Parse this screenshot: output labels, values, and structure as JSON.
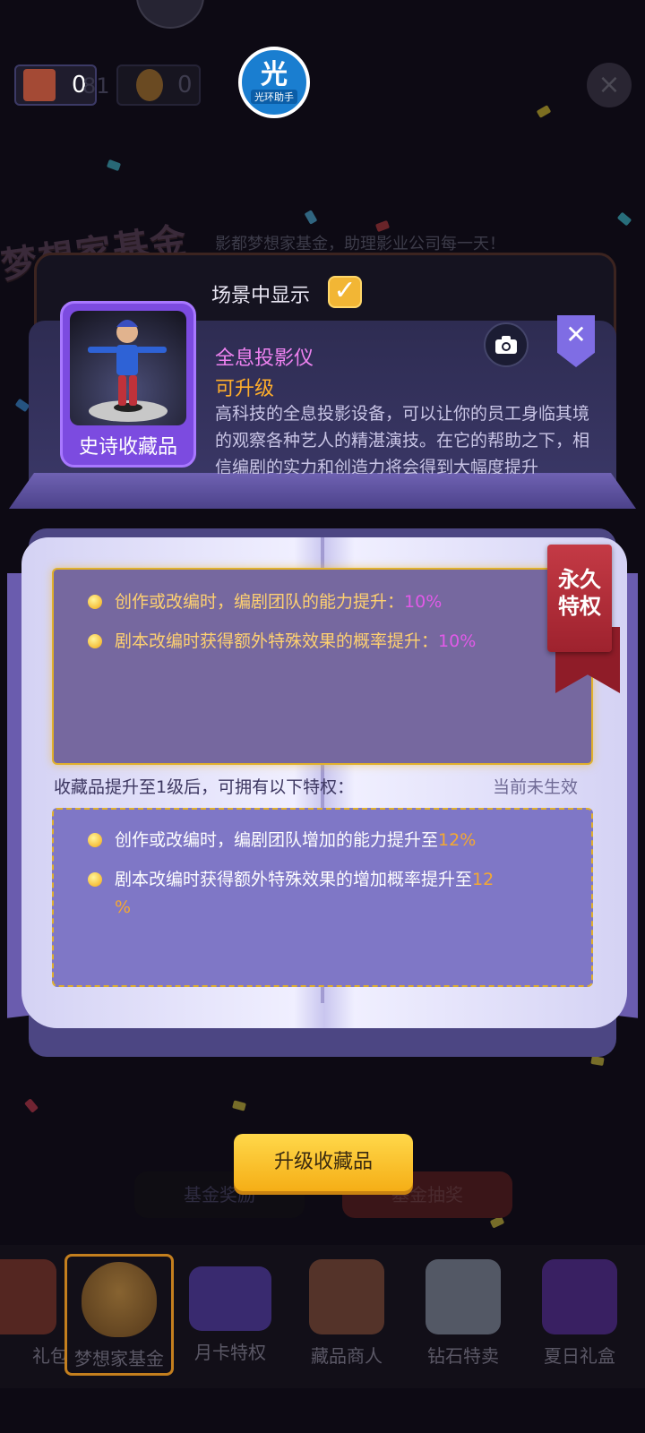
{
  "top_bar": {
    "res1_value": "0",
    "res1_overlay": "81",
    "res2_value": "0",
    "helper_glyph": "光",
    "helper_label": "光环助手",
    "close_glyph": "×"
  },
  "background": {
    "fund_title": "梦想家基金",
    "fund_subtitle": "影都梦想家基金，助理影业公司每一天！"
  },
  "scene": {
    "label": "场景中显示",
    "checked": true,
    "check_glyph": "✓"
  },
  "item": {
    "rarity": "史诗收藏品",
    "name": "全息投影仪",
    "upgrade_status": "可升级",
    "description": "高科技的全息投影设备，可以让你的员工身临其境的观察各种艺人的精湛演技。在它的帮助之下，相信编剧的实力和创造力将会得到大幅度提升",
    "close_glyph": "✕"
  },
  "permanent": {
    "ribbon_line1": "永久",
    "ribbon_line2": "特权",
    "perks": [
      {
        "text": "创作或改编时，编剧团队的能力提升：",
        "value": "10%"
      },
      {
        "text": "剧本改编时获得额外特殊效果的概率提升：",
        "value": "10%"
      }
    ]
  },
  "next_level": {
    "note": "收藏品提升至1级后，可拥有以下特权：",
    "status": "当前未生效",
    "perks": [
      {
        "text": "创作或改编时，编剧团队增加的能力提升至",
        "value": "12%"
      },
      {
        "text": "剧本改编时获得额外特殊效果的增加概率提升至",
        "value": "12",
        "value_tail": "%"
      }
    ]
  },
  "actions": {
    "upgrade": "升级收藏品",
    "fund_rewards": "基金奖励",
    "fund_lottery": "基金抽奖"
  },
  "tabs": [
    {
      "label": "礼包",
      "color": "#8a3b2a"
    },
    {
      "label": "梦想家基金",
      "color": "#d99a2a",
      "active": true
    },
    {
      "label": "月卡特权",
      "color": "#6a4ad0"
    },
    {
      "label": "藏品商人",
      "color": "#a0603a"
    },
    {
      "label": "钻石特卖",
      "color": "#9aa6b8"
    },
    {
      "label": "夏日礼盒",
      "color": "#6a3ab8"
    }
  ]
}
